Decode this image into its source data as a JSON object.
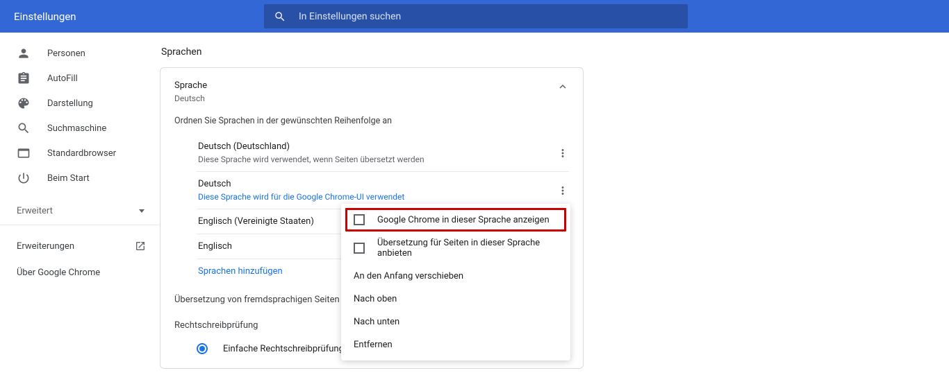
{
  "header": {
    "title": "Einstellungen",
    "search_placeholder": "In Einstellungen suchen"
  },
  "sidebar": {
    "items": [
      {
        "label": "Personen"
      },
      {
        "label": "AutoFill"
      },
      {
        "label": "Darstellung"
      },
      {
        "label": "Suchmaschine"
      },
      {
        "label": "Standardbrowser"
      },
      {
        "label": "Beim Start"
      }
    ],
    "advanced": "Erweitert",
    "extensions": "Erweiterungen",
    "about": "Über Google Chrome"
  },
  "main": {
    "section_title": "Sprachen",
    "language_card": {
      "title": "Sprache",
      "subtitle": "Deutsch",
      "instruction": "Ordnen Sie Sprachen in der gewünschten Reihenfolge an",
      "langs": [
        {
          "name": "Deutsch (Deutschland)",
          "desc": "Diese Sprache wird verwendet, wenn Seiten übersetzt werden",
          "blue": false
        },
        {
          "name": "Deutsch",
          "desc": "Diese Sprache wird für die Google Chrome-UI verwendet",
          "blue": true
        },
        {
          "name": "Englisch (Vereinigte Staaten)",
          "desc": "",
          "blue": false
        },
        {
          "name": "Englisch",
          "desc": "",
          "blue": false
        }
      ],
      "add_lang": "Sprachen hinzufügen",
      "translate_offer": "Übersetzung von fremdsprachigen Seiten anbie",
      "spellcheck": "Rechtschreibprüfung",
      "radio_label": "Einfache Rechtschreibprüfung"
    }
  },
  "ctx": {
    "display_in_lang": "Google Chrome in dieser Sprache anzeigen",
    "offer_translate": "Übersetzung für Seiten in dieser Sprache anbieten",
    "move_top": "An den Anfang verschieben",
    "move_up": "Nach oben",
    "move_down": "Nach unten",
    "remove": "Entfernen"
  }
}
